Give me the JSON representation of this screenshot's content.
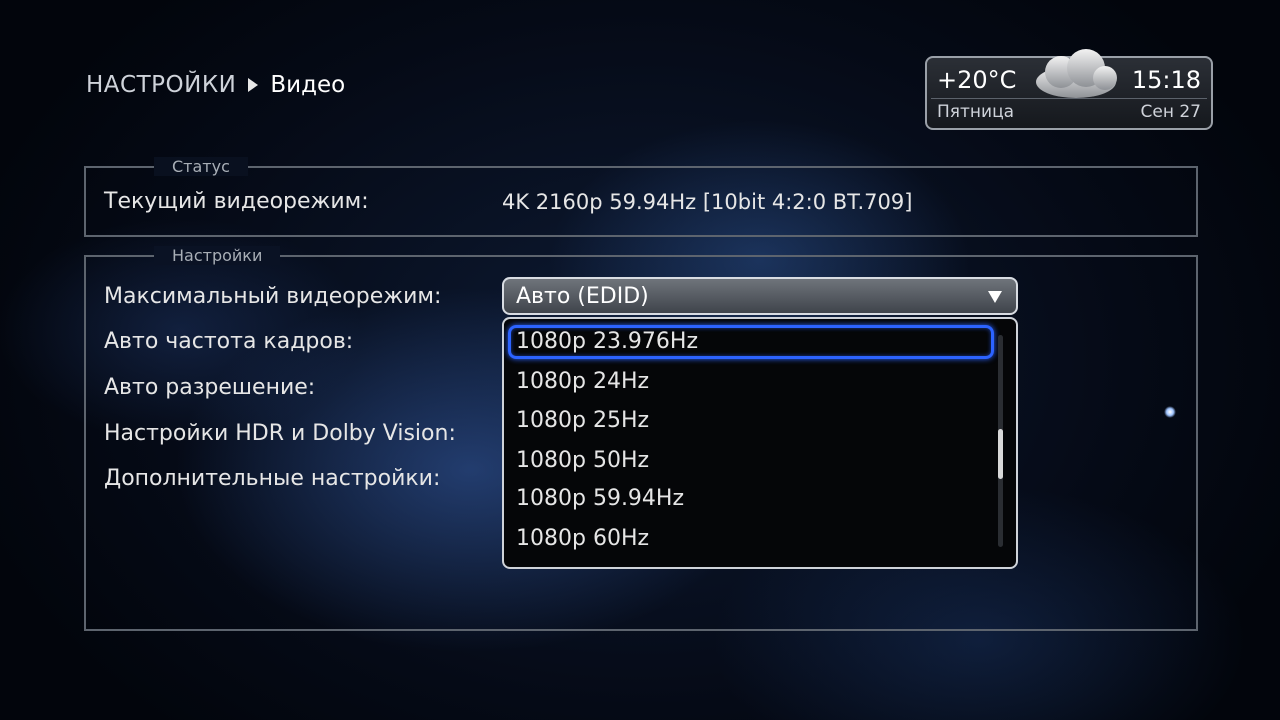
{
  "breadcrumb": {
    "root": "НАСТРОЙКИ",
    "current": "Видео"
  },
  "weather": {
    "temperature": "+20°C",
    "time": "15:18",
    "day": "Пятница",
    "date": "Сен 27",
    "icon": "cloud-icon"
  },
  "status_group": {
    "title": "Статус",
    "label": "Текущий видеорежим:",
    "value": "4K 2160p 59.94Hz [10bit 4:2:0 BT.709]"
  },
  "settings_group": {
    "title": "Настройки",
    "items": [
      {
        "label": "Максимальный видеорежим:"
      },
      {
        "label": "Авто частота кадров:"
      },
      {
        "label": "Авто разрешение:"
      },
      {
        "label": "Настройки HDR и Dolby Vision:"
      },
      {
        "label": "Дополнительные настройки:"
      }
    ],
    "max_mode_select": {
      "value": "Авто (EDID)",
      "options": [
        "1080p 23.976Hz",
        "1080p 24Hz",
        "1080p 25Hz",
        "1080p 50Hz",
        "1080p 59.94Hz",
        "1080p 60Hz"
      ],
      "focused_index": 0
    }
  },
  "colors": {
    "accent": "#2c63ff",
    "border": "#5d646e"
  }
}
